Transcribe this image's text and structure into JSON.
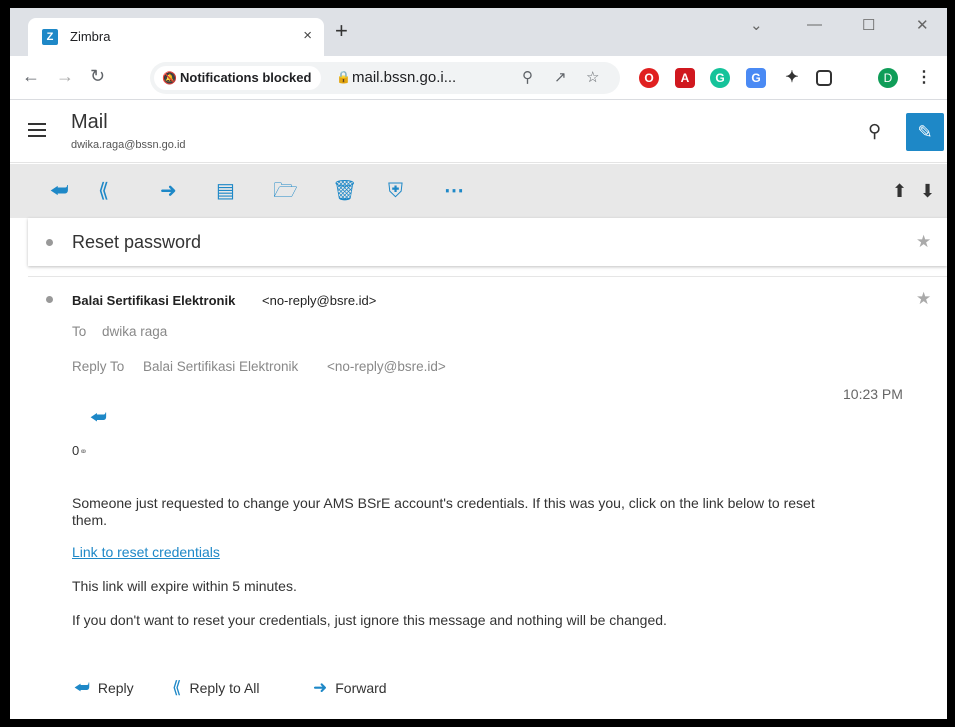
{
  "browser": {
    "tab_favicon": "Z",
    "tab_title": "Zimbra",
    "tab_close": "×",
    "new_tab": "+",
    "notifications_chip": "Notifications blocked",
    "url": "mail.bssn.go.i...",
    "profile_initial": "D"
  },
  "header": {
    "app_title": "Mail",
    "account": "dwika.raga@bssn.go.id"
  },
  "message": {
    "subject": "Reset password",
    "from_name": "Balai Sertifikasi Elektronik",
    "from_address": "<no-reply@bsre.id>",
    "to_label": "To",
    "to_value": "dwika raga",
    "reply_to_label": "Reply To",
    "reply_to_name": "Balai Sertifikasi Elektronik",
    "reply_to_address": "<no-reply@bsre.id>",
    "time": "10:23 PM",
    "attachment_count": "0",
    "body_line1": "Someone just requested to change your AMS BSrE account's credentials. If this was you, click on the link below to reset",
    "body_line2": "them.",
    "reset_link": "Link to reset credentials",
    "expiry_note": "This link will expire within 5 minutes.",
    "ignore_note": "If you don't want to reset your credentials, just ignore this message and nothing will be changed."
  },
  "footer_actions": {
    "reply": "Reply",
    "reply_all": "Reply to All",
    "forward": "Forward"
  },
  "colors": {
    "accent": "#1e88c7",
    "action_bar_bg": "#e8e8e8"
  }
}
